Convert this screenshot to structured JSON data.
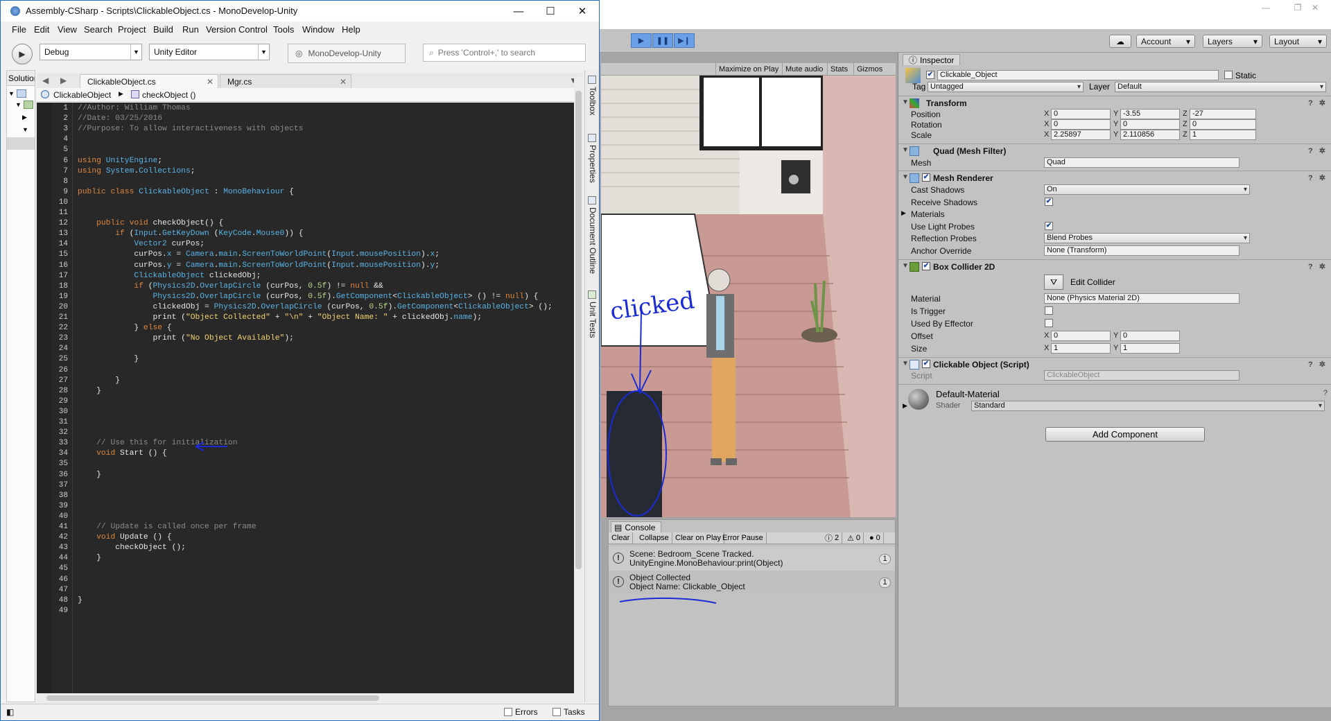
{
  "monodevelop": {
    "title": "Assembly-CSharp - Scripts\\ClickableObject.cs - MonoDevelop-Unity",
    "menu": [
      "File",
      "Edit",
      "View",
      "Search",
      "Project",
      "Build",
      "Run",
      "Version Control",
      "Tools",
      "Window",
      "Help"
    ],
    "config": "Debug",
    "target": "Unity Editor",
    "status": "MonoDevelop-Unity",
    "search_placeholder": "Press 'Control+,' to search",
    "solution_label": "Solution",
    "tabs": [
      {
        "label": "ClickableObject.cs",
        "active": true
      },
      {
        "label": "Mgr.cs",
        "active": false
      }
    ],
    "breadcrumb": {
      "class": "ClickableObject",
      "method": "checkObject ()"
    },
    "side_pads": [
      "Toolbox",
      "Properties",
      "Document Outline",
      "Unit Tests"
    ],
    "statusbar": {
      "errors": "Errors",
      "tasks": "Tasks"
    },
    "code_lines": [
      "//Author: William Thomas",
      "//Date: 03/25/2016",
      "//Purpose: To allow interactiveness with objects",
      "",
      "",
      "using UnityEngine;",
      "using System.Collections;",
      "",
      "public class ClickableObject : MonoBehaviour {",
      "",
      "",
      "    public void checkObject() {",
      "        if (Input.GetKeyDown (KeyCode.Mouse0)) {",
      "            Vector2 curPos;",
      "            curPos.x = Camera.main.ScreenToWorldPoint(Input.mousePosition).x;",
      "            curPos.y = Camera.main.ScreenToWorldPoint(Input.mousePosition).y;",
      "            ClickableObject clickedObj;",
      "            if (Physics2D.OverlapCircle (curPos, 0.5f) != null &&",
      "                Physics2D.OverlapCircle (curPos, 0.5f).GetComponent<ClickableObject> () != null) {",
      "                clickedObj = Physics2D.OverlapCircle (curPos, 0.5f).GetComponent<ClickableObject> ();",
      "                print (\"Object Collected\" + \"\\n\" + \"Object Name: \" + clickedObj.name);",
      "            } else {",
      "                print (\"No Object Available\");",
      "",
      "            }",
      "",
      "        }",
      "    }",
      "",
      "",
      "",
      "",
      "    // Use this for initialization",
      "    void Start () {",
      "",
      "    }",
      "",
      "",
      "",
      "",
      "    // Update is called once per frame",
      "    void Update () {",
      "        checkObject ();",
      "    }",
      "",
      "",
      "",
      "}",
      ""
    ]
  },
  "unity": {
    "toolbar": {
      "account": "Account",
      "layers": "Layers",
      "layout": "Layout"
    },
    "game_toolbar": [
      "Maximize on Play",
      "Mute audio",
      "Stats",
      "Gizmos"
    ],
    "annotation_text": "clicked",
    "console": {
      "tab": "Console",
      "buttons": [
        "Clear",
        "Collapse",
        "Clear on Play",
        "Error Pause"
      ],
      "counts": {
        "info": "2",
        "warn": "0",
        "error": "0"
      },
      "messages": [
        {
          "line1": "Scene: Bedroom_Scene Tracked.",
          "line2": "UnityEngine.MonoBehaviour:print(Object)",
          "count": "1"
        },
        {
          "line1": "Object Collected",
          "line2": "Object Name: Clickable_Object",
          "count": "1"
        }
      ]
    },
    "inspector": {
      "tab": "Inspector",
      "object_name": "Clickable_Object",
      "static_label": "Static",
      "tag_label": "Tag",
      "tag": "Untagged",
      "layer_label": "Layer",
      "layer": "Default",
      "transform": {
        "title": "Transform",
        "position_label": "Position",
        "position": [
          "0",
          "-3.55",
          "-27"
        ],
        "rotation_label": "Rotation",
        "rotation": [
          "0",
          "0",
          "0"
        ],
        "scale_label": "Scale",
        "scale": [
          "2.25897",
          "2.110856",
          "1"
        ]
      },
      "axes": [
        "X",
        "Y",
        "Z"
      ],
      "mesh_filter": {
        "title": "Quad (Mesh Filter)",
        "mesh_label": "Mesh",
        "mesh": "Quad"
      },
      "mesh_renderer": {
        "title": "Mesh Renderer",
        "cast_shadows_label": "Cast Shadows",
        "cast_shadows": "On",
        "receive_shadows_label": "Receive Shadows",
        "materials_label": "Materials",
        "light_probes_label": "Use Light Probes",
        "reflection_probes_label": "Reflection Probes",
        "reflection_probes": "Blend Probes",
        "anchor_override_label": "Anchor Override",
        "anchor_override": "None (Transform)"
      },
      "box_collider": {
        "title": "Box Collider 2D",
        "edit_collider": "Edit Collider",
        "material_label": "Material",
        "material": "None (Physics Material 2D)",
        "is_trigger_label": "Is Trigger",
        "used_by_effector_label": "Used By Effector",
        "offset_label": "Offset",
        "offset": [
          "0",
          "0"
        ],
        "size_label": "Size",
        "size": [
          "1",
          "1"
        ]
      },
      "script": {
        "title": "Clickable Object (Script)",
        "script_label": "Script",
        "script": "ClickableObject"
      },
      "material": {
        "name": "Default-Material",
        "shader_label": "Shader",
        "shader": "Standard"
      },
      "add_component": "Add Component"
    }
  }
}
